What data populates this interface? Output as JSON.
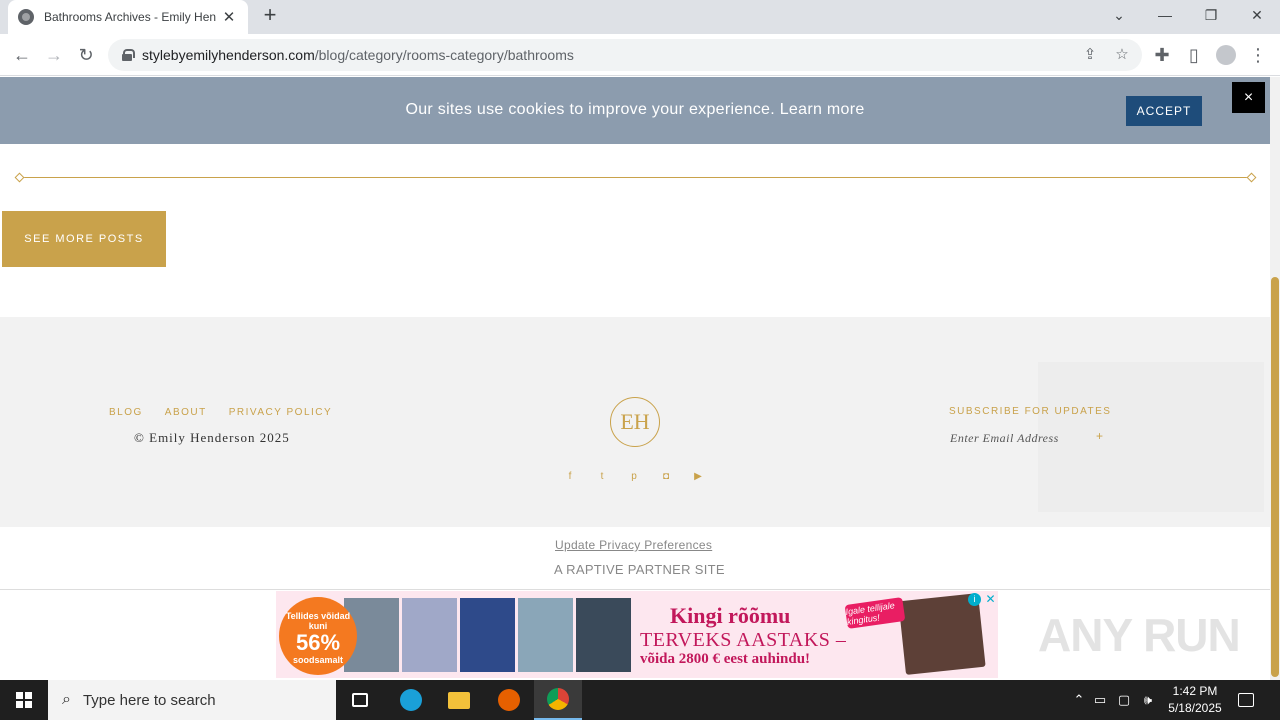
{
  "browser": {
    "tab_title": "Bathrooms Archives - Emily Henderson",
    "url_host": "stylebyemilyhenderson.com",
    "url_path": "/blog/category/rooms-category/bathrooms"
  },
  "cookie_bar": {
    "text": "Our sites use cookies to improve your experience. Learn more",
    "accept_label": "ACCEPT",
    "close_label": "×"
  },
  "main": {
    "see_more_label": "SEE MORE POSTS"
  },
  "footer": {
    "nav": [
      "BLOG",
      "ABOUT",
      "PRIVACY POLICY"
    ],
    "copyright": "© Emily Henderson 2025",
    "logo_text": "EH",
    "subscribe_title": "SUBSCRIBE FOR UPDATES",
    "email_placeholder": "Enter Email Address",
    "submit_label": "+",
    "social_icons": [
      "facebook-icon",
      "twitter-icon",
      "pinterest-icon",
      "instagram-icon",
      "youtube-icon"
    ]
  },
  "below_footer": {
    "privacy_link": "Update Privacy Preferences",
    "partner_text": "A RAPTIVE PARTNER SITE"
  },
  "ad": {
    "badge_line1": "Tellides võidad kuni",
    "badge_percent": "56%",
    "badge_line2": "soodsamalt",
    "headline": "Kingi rõõmu",
    "line2": "TERVEKS AASTAKS –",
    "line3": "võida 2800 € eest auhindu!",
    "tag": "Igale tellijale kingitus!",
    "info_label": "i",
    "close_label": "✕"
  },
  "watermark": "ANY RUN",
  "taskbar": {
    "search_placeholder": "Type here to search",
    "time": "1:42 PM",
    "date": "5/18/2025"
  },
  "colors": {
    "gold": "#c9a24b",
    "cookie_bar": "#8c9cae",
    "accept": "#1e4c7a"
  }
}
